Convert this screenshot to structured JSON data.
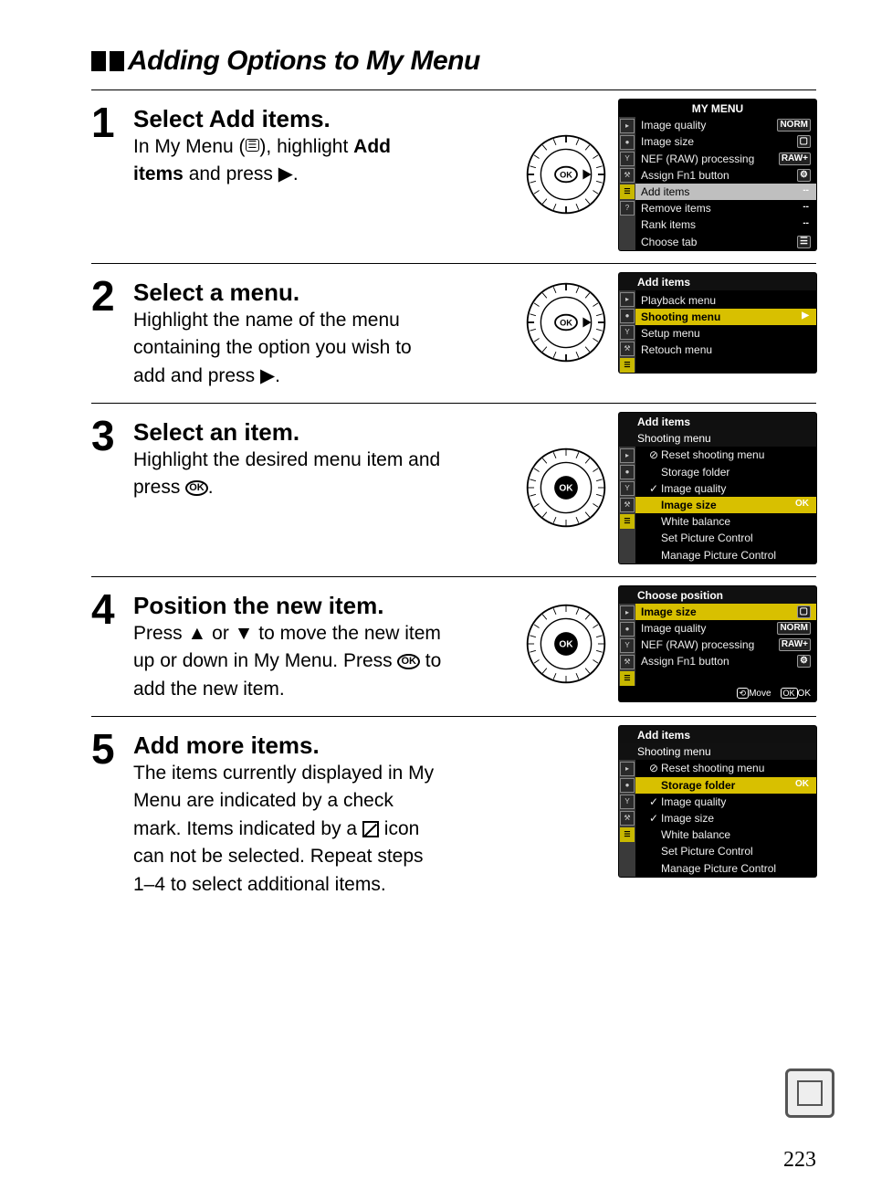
{
  "header": "Adding Options to My Menu",
  "page_number": "223",
  "steps": [
    {
      "num": "1",
      "title": "Select Add items.",
      "desc_html": "In My Menu (<span class='menu-glyph'>☰</span>), highlight <b>Add items</b> and press <span class='glyph'>▶</span>.",
      "dial_variant": "right",
      "lcd": {
        "title": "MY MENU",
        "title_align": "center",
        "tabs": [
          false,
          false,
          false,
          false,
          true,
          false
        ],
        "rows": [
          {
            "label": "Image quality",
            "val": "NORM"
          },
          {
            "label": "Image size",
            "val": "▢"
          },
          {
            "label": "NEF (RAW) processing",
            "val": "RAW+"
          },
          {
            "label": "Assign Fn1 button",
            "val": "⚙"
          },
          {
            "label": "Add items",
            "val": "--",
            "hl": "white"
          },
          {
            "label": "Remove items",
            "val": "--"
          },
          {
            "label": "Rank items",
            "val": "--"
          },
          {
            "label": "Choose tab",
            "val": "☰"
          }
        ]
      }
    },
    {
      "num": "2",
      "title": "Select a menu.",
      "desc_html": "Highlight the name of the menu containing the option you wish to add and press <span class='glyph'>▶</span>.",
      "dial_variant": "right",
      "lcd": {
        "title": "Add items",
        "title_align": "left",
        "tabs": [
          false,
          false,
          false,
          false,
          true
        ],
        "rows": [
          {
            "label": " "
          },
          {
            "label": "Playback menu"
          },
          {
            "label": "Shooting menu",
            "val": "▶",
            "hl": "yellow"
          },
          {
            "label": "Setup menu"
          },
          {
            "label": "Retouch menu"
          },
          {
            "label": " "
          },
          {
            "label": " "
          }
        ]
      }
    },
    {
      "num": "3",
      "title": "Select an item.",
      "desc_html": "Highlight the desired menu item and press <span class='ok-inline'>OK</span>.",
      "dial_variant": "ok",
      "lcd": {
        "title": "Add items",
        "title_align": "left",
        "sub": "Shooting menu",
        "tabs": [
          false,
          false,
          false,
          false,
          true
        ],
        "rows": [
          {
            "pre": "⊘",
            "label": "Reset shooting menu",
            "indent": true
          },
          {
            "pre": "",
            "label": "Storage folder",
            "indent": true
          },
          {
            "pre": "✓",
            "label": "Image quality",
            "indent": true
          },
          {
            "pre": "",
            "label": "Image size",
            "indent": true,
            "hl": "yellow",
            "val": "OK"
          },
          {
            "pre": "",
            "label": "White balance",
            "indent": true
          },
          {
            "pre": "",
            "label": "Set Picture Control",
            "indent": true
          },
          {
            "pre": "",
            "label": "Manage Picture Control",
            "indent": true
          }
        ]
      }
    },
    {
      "num": "4",
      "title": "Position the new item.",
      "desc_html": "Press <span class='glyph'>▲</span> or <span class='glyph'>▼</span> to move the new item up or down in My Menu. Press <span class='ok-inline'>OK</span> to add the new item.",
      "dial_variant": "ok",
      "lcd": {
        "title": "Choose position",
        "title_align": "left",
        "tabs": [
          false,
          false,
          false,
          false,
          true
        ],
        "rows": [
          {
            "label": "Image size",
            "val": "▢",
            "hl": "yellow"
          },
          {
            "label": "Image quality",
            "val": "NORM"
          },
          {
            "label": "NEF (RAW) processing",
            "val": "RAW+"
          },
          {
            "label": "Assign Fn1 button",
            "val": "⚙"
          },
          {
            "label": " "
          },
          {
            "label": " "
          }
        ],
        "footer": [
          {
            "icon": "⟲",
            "text": "Move"
          },
          {
            "icon": "OK",
            "text": "OK"
          }
        ]
      }
    },
    {
      "num": "5",
      "title": "Add more items.",
      "desc_html": "The items currently displayed in My Menu are indicated by a check mark.  Items indicated by a <span class='square-slash'></span> icon can not be selected.  Repeat steps 1–4 to select additional items.",
      "dial_variant": "none",
      "lcd": {
        "title": "Add items",
        "title_align": "left",
        "sub": "Shooting menu",
        "tabs": [
          false,
          false,
          false,
          false,
          true
        ],
        "rows": [
          {
            "pre": "⊘",
            "label": "Reset shooting menu",
            "indent": true
          },
          {
            "pre": "",
            "label": "Storage folder",
            "indent": true,
            "hl": "yellow",
            "val": "OK"
          },
          {
            "pre": "✓",
            "label": "Image quality",
            "indent": true
          },
          {
            "pre": "✓",
            "label": "Image size",
            "indent": true
          },
          {
            "pre": "",
            "label": "White balance",
            "indent": true
          },
          {
            "pre": "",
            "label": "Set Picture Control",
            "indent": true
          },
          {
            "pre": "",
            "label": "Manage Picture Control",
            "indent": true
          }
        ]
      }
    }
  ]
}
